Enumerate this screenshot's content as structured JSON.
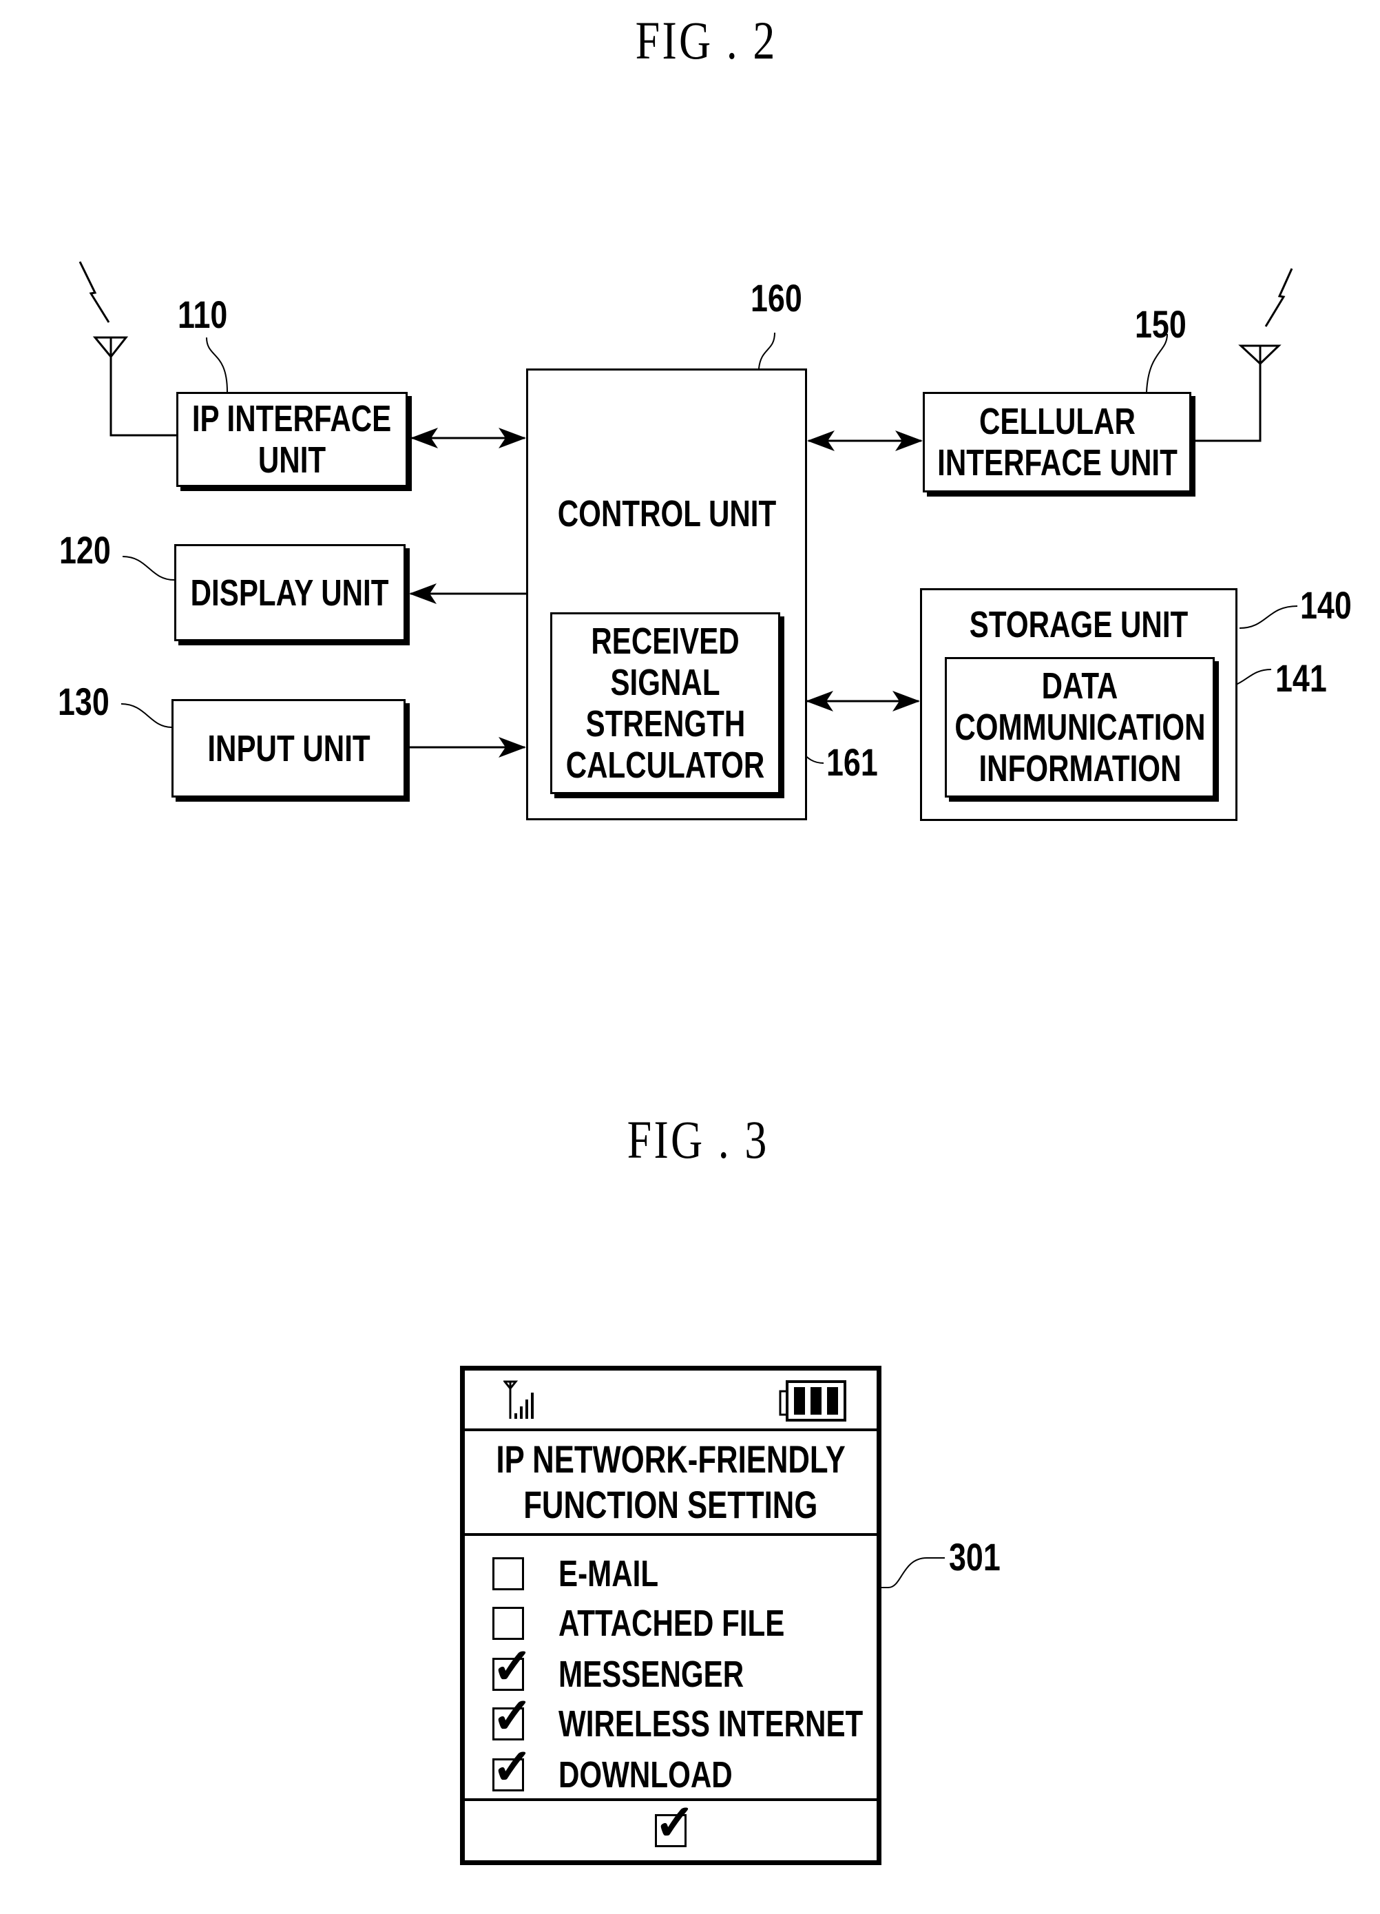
{
  "fig2": {
    "title": "FIG . 2",
    "blocks": {
      "ip_interface": {
        "ref": "110",
        "lines": [
          "IP INTERFACE",
          "UNIT"
        ]
      },
      "display": {
        "ref": "120",
        "lines": [
          "DISPLAY UNIT"
        ]
      },
      "input": {
        "ref": "130",
        "lines": [
          "INPUT UNIT"
        ]
      },
      "storage": {
        "ref": "140",
        "lines": [
          "STORAGE UNIT"
        ]
      },
      "data_comm": {
        "ref": "141",
        "lines": [
          "DATA",
          "COMMUNICATION",
          "INFORMATION"
        ]
      },
      "cellular": {
        "ref": "150",
        "lines": [
          "CELLULAR",
          "INTERFACE UNIT"
        ]
      },
      "control": {
        "ref": "160",
        "lines": [
          "CONTROL UNIT"
        ]
      },
      "rssi_calc": {
        "ref": "161",
        "lines": [
          "RECEIVED",
          "SIGNAL",
          "STRENGTH",
          "CALCULATOR"
        ]
      }
    },
    "connections": [
      {
        "from": "ip_interface",
        "to": "control",
        "direction": "bidirectional"
      },
      {
        "from": "control",
        "to": "display",
        "direction": "one-way"
      },
      {
        "from": "input",
        "to": "control",
        "direction": "one-way"
      },
      {
        "from": "control",
        "to": "cellular",
        "direction": "bidirectional"
      },
      {
        "from": "control",
        "to": "storage",
        "direction": "bidirectional"
      }
    ],
    "antennas": [
      "ip_interface",
      "cellular"
    ]
  },
  "fig3": {
    "title": "FIG . 3",
    "ref": "301",
    "status": {
      "signal_icon": "signal-strength-icon",
      "battery_icon": "battery-full-icon",
      "battery_bars": 3
    },
    "screen_title": [
      "IP NETWORK-FRIENDLY",
      "FUNCTION SETTING"
    ],
    "options": [
      {
        "label": "E-MAIL",
        "checked": false,
        "mark": ""
      },
      {
        "label": "ATTACHED FILE",
        "checked": false,
        "mark": ""
      },
      {
        "label": "MESSENGER",
        "checked": true,
        "mark": "✓"
      },
      {
        "label": "WIRELESS INTERNET",
        "checked": true,
        "mark": "✓"
      },
      {
        "label": "DOWNLOAD",
        "checked": true,
        "mark": "✓"
      }
    ],
    "softkey_mark": "✓"
  }
}
